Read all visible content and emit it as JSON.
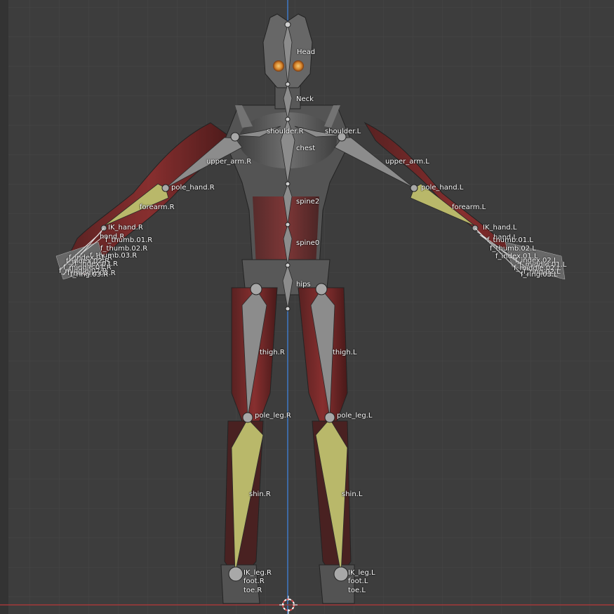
{
  "viewport": {
    "background": "#3d3d3d",
    "grid_color": "#474747",
    "axis_vertical_color": "#3f79c6",
    "axis_horizontal_color": "#a3383a",
    "bone_color": "#8c8c8c",
    "ik_bone_color": "#b9b86a",
    "origin_marker": "3d-cursor-icon"
  },
  "bones": {
    "head": "Head",
    "neck": "Neck",
    "shoulder_r": "shoulder.R",
    "shoulder_l": "shoulder.L",
    "chest": "chest",
    "upper_arm_r": "upper_arm.R",
    "upper_arm_l": "upper_arm.L",
    "pole_hand_r": "pole_hand.R",
    "pole_hand_l": "pole_hand.L",
    "spine2": "spine2",
    "forearm_r": "forearm.R",
    "forearm_l": "forearm.L",
    "ik_hand_r": "IK_hand.R",
    "ik_hand_l": "IK_hand.L",
    "hand_r": "hand.R",
    "hand_l": "hand.L",
    "thumb01_r": "f_thumb.01.R",
    "thumb01_l": "f_thumb.01.L",
    "thumb02_r": "f_thumb.02.R",
    "thumb02_l": "f_thumb.02.L",
    "thumb03_r": "f_thumb.03.R",
    "spine0": "spine0",
    "hips": "hips",
    "thigh_r": "thigh.R",
    "thigh_l": "thigh.L",
    "pole_leg_r": "pole_leg.R",
    "pole_leg_l": "pole_leg.L",
    "shin_r": "shin.R",
    "shin_l": "shin.L",
    "ik_leg_r": "IK_leg.R",
    "ik_leg_l": "IK_leg.L",
    "foot_r": "foot.R",
    "foot_l": "foot.L",
    "toe_r": "toe.R",
    "toe_l": "toe.L",
    "finger_crowd_r": [
      "f_index.01.R",
      "f_index.02.R",
      "f_index.03.R",
      "f_middle.01.R",
      "f_middle.02.R",
      "f_middle.03.R",
      "f_ring.03.R"
    ],
    "finger_crowd_l": [
      "f_index.01.L",
      "f_index.02.L",
      "f_middle.01.L",
      "f_middle.02.L",
      "f_ring.02.L",
      "f_ring.03.L"
    ]
  }
}
